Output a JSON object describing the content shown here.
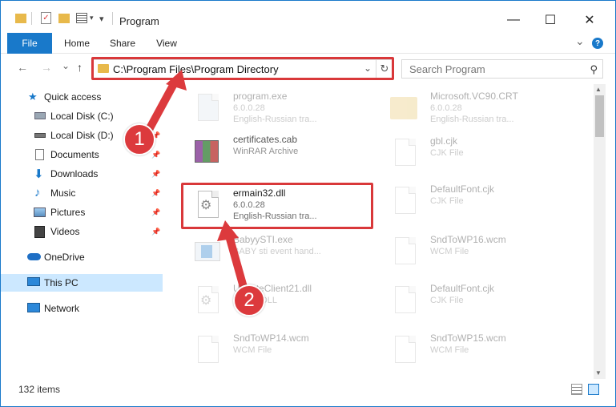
{
  "window": {
    "title": "Program",
    "minimize_glyph": "—",
    "maximize_glyph": "☐",
    "close_glyph": "✕"
  },
  "ribbon": {
    "tabs": [
      "File",
      "Home",
      "Share",
      "View"
    ],
    "help_glyph": "?",
    "collapse_glyph": "⌄"
  },
  "nav": {
    "back_glyph": "←",
    "forward_glyph": "→",
    "recent_glyph": "⌄",
    "up_glyph": "↑",
    "address": "C:\\Program Files\\Program Directory",
    "search_placeholder": "Search Program"
  },
  "sidebar": {
    "items": [
      {
        "label": "Quick access",
        "icon": "star-icon",
        "pinned": false,
        "selected": false
      },
      {
        "label": "Local Disk (C:)",
        "icon": "drive-icon",
        "pinned": true,
        "selected": false
      },
      {
        "label": "Local Disk (D:)",
        "icon": "drive-icon",
        "pinned": true,
        "selected": false
      },
      {
        "label": "Documents",
        "icon": "documents-icon",
        "pinned": true,
        "selected": false
      },
      {
        "label": "Downloads",
        "icon": "downloads-icon",
        "pinned": true,
        "selected": false
      },
      {
        "label": "Music",
        "icon": "music-icon",
        "pinned": true,
        "selected": false
      },
      {
        "label": "Pictures",
        "icon": "pictures-icon",
        "pinned": true,
        "selected": false
      },
      {
        "label": "Videos",
        "icon": "videos-icon",
        "pinned": true,
        "selected": false
      },
      {
        "label": "OneDrive",
        "icon": "onedrive-icon",
        "pinned": false,
        "selected": false
      },
      {
        "label": "This PC",
        "icon": "this-pc-icon",
        "pinned": false,
        "selected": true
      },
      {
        "label": "Network",
        "icon": "network-icon",
        "pinned": false,
        "selected": false
      }
    ]
  },
  "files": {
    "left": [
      {
        "name": "program.exe",
        "line1": "6.0.0.28",
        "line2": "English-Russian tra...",
        "icon": "exe-icon",
        "faded": true
      },
      {
        "name": "certificates.cab",
        "line1": "WinRAR Archive",
        "line2": "",
        "icon": "winrar-archive-icon",
        "faded": true
      },
      {
        "name": "ermain32.dll",
        "line1": "6.0.0.28",
        "line2": "English-Russian tra...",
        "icon": "dll-gear-icon",
        "faded": false
      },
      {
        "name": "BabyySTI.exe",
        "line1": "BABY sti event hand...",
        "line2": "",
        "icon": "exe-icon",
        "faded": true
      },
      {
        "name": "UpdateClient21.dll",
        "line1": "Kernel DLL",
        "line2": "",
        "icon": "dll-gear-icon",
        "faded": true
      },
      {
        "name": "SndToWP14.wcm",
        "line1": "WCM File",
        "line2": "",
        "icon": "blank-file-icon",
        "faded": true
      }
    ],
    "right": [
      {
        "name": "Microsoft.VC90.CRT",
        "line1": "6.0.0.28",
        "line2": "English-Russian tra...",
        "icon": "folder-icon",
        "faded": true
      },
      {
        "name": "gbl.cjk",
        "line1": "CJK File",
        "line2": "",
        "icon": "blank-file-icon",
        "faded": true
      },
      {
        "name": "DefaultFont.cjk",
        "line1": "CJK File",
        "line2": "",
        "icon": "blank-file-icon",
        "faded": true
      },
      {
        "name": "SndToWP16.wcm",
        "line1": "WCM File",
        "line2": "",
        "icon": "blank-file-icon",
        "faded": true
      },
      {
        "name": "DefaultFont.cjk",
        "line1": "CJK File",
        "line2": "",
        "icon": "blank-file-icon",
        "faded": true
      },
      {
        "name": "SndToWP15.wcm",
        "line1": "WCM File",
        "line2": "",
        "icon": "blank-file-icon",
        "faded": true
      }
    ]
  },
  "status": {
    "item_count": "132 items"
  },
  "annotations": {
    "step1": "1",
    "step2": "2",
    "color": "#dc3a3d"
  },
  "colors": {
    "accent": "#1979ca",
    "selection": "#cce8ff",
    "folder": "#e8b94b"
  }
}
